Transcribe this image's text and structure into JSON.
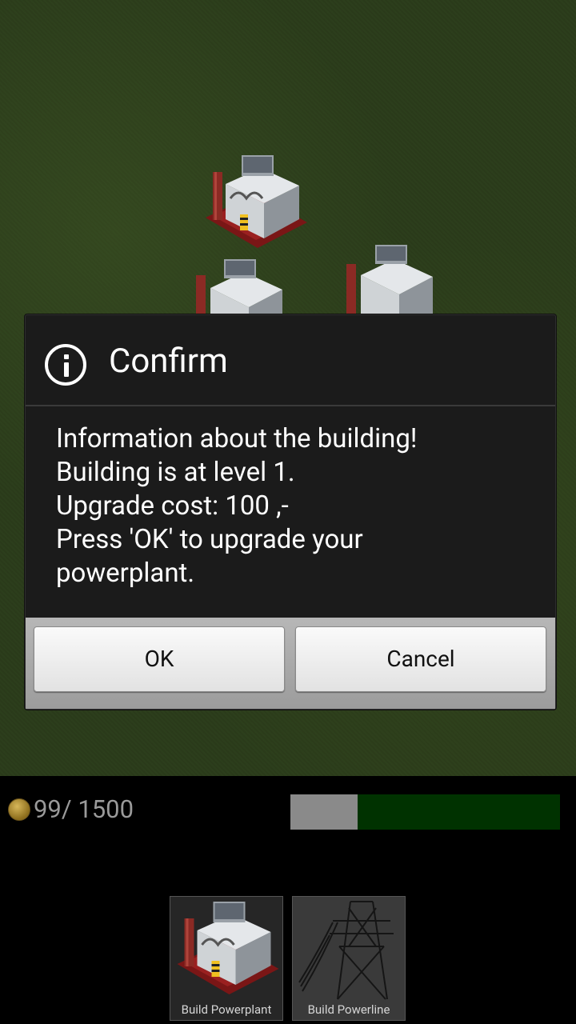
{
  "dialog": {
    "title": "Confirm",
    "icon": "info-icon",
    "message_lines": [
      "Information about the building!",
      "Building is at level 1.",
      "Upgrade cost: 100 ,-",
      "Press 'OK' to upgrade your",
      "powerplant."
    ],
    "ok_label": "OK",
    "cancel_label": "Cancel"
  },
  "hud": {
    "money": "99/ 1500",
    "progress_fraction": 0.25
  },
  "toolbar": {
    "build_powerplant_label": "Build Powerplant",
    "build_powerline_label": "Build Powerline"
  },
  "colors": {
    "grass": "#2b3c1b",
    "progress_bg": "#003200",
    "progress_fill": "#8a8a8a"
  }
}
